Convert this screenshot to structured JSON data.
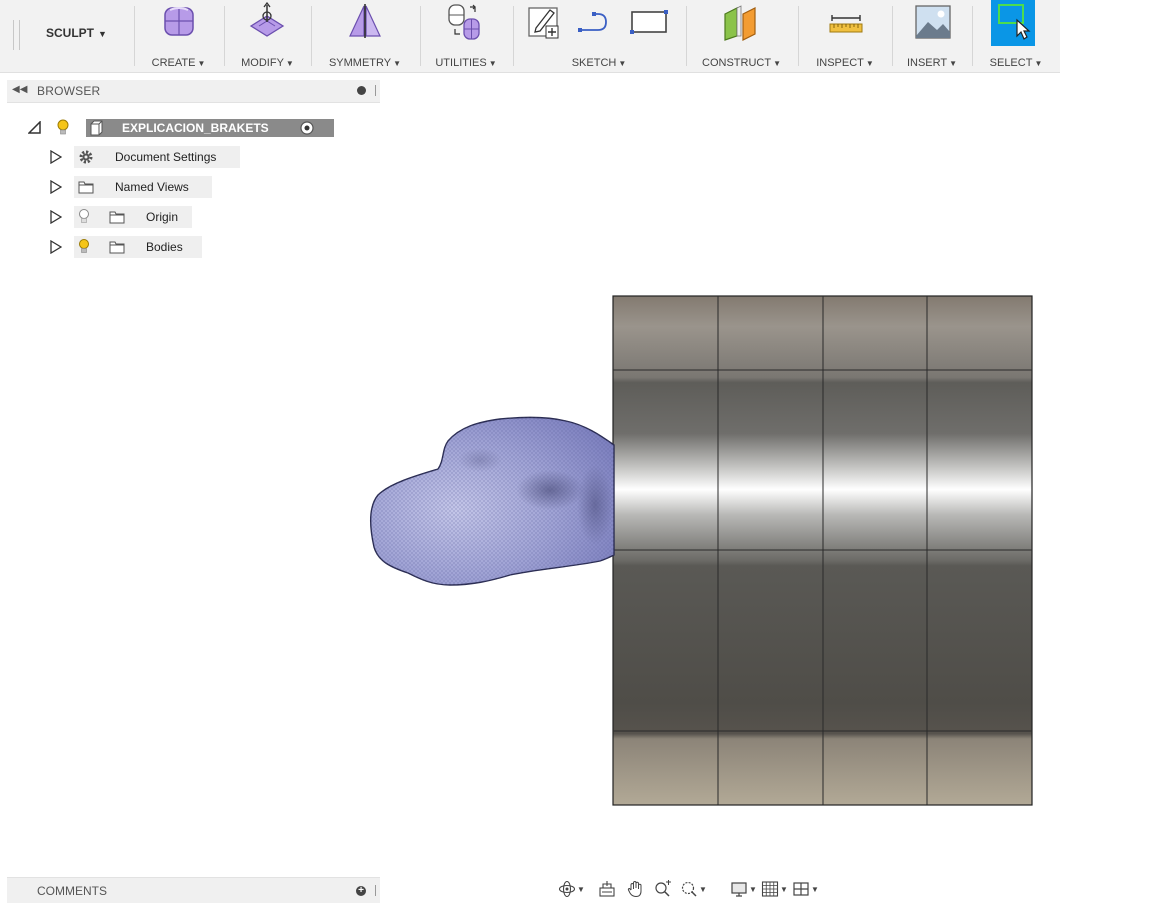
{
  "toolbar": {
    "workspace": "SCULPT",
    "groups": [
      {
        "label": "CREATE",
        "icon": "box-form-icon"
      },
      {
        "label": "MODIFY",
        "icon": "modify-form-icon"
      },
      {
        "label": "SYMMETRY",
        "icon": "symmetry-icon"
      },
      {
        "label": "UTILITIES",
        "icon": "utilities-icon"
      },
      {
        "label": "SKETCH",
        "icon": "sketch-icon"
      },
      {
        "label": "CONSTRUCT",
        "icon": "construct-plane-icon"
      },
      {
        "label": "INSPECT",
        "icon": "measure-icon"
      },
      {
        "label": "INSERT",
        "icon": "insert-image-icon"
      },
      {
        "label": "SELECT",
        "icon": "select-icon"
      }
    ],
    "colors": {
      "select_active": "#0a96e6",
      "form_purple": "#a98ce0"
    }
  },
  "browser": {
    "title": "BROWSER",
    "root": {
      "name": "EXPLICACION_BRAKETS"
    },
    "items": [
      {
        "label": "Document Settings",
        "icon": "gear-icon"
      },
      {
        "label": "Named Views",
        "icon": "folder-icon"
      },
      {
        "label": "Origin",
        "icon": "folder-icon"
      },
      {
        "label": "Bodies",
        "icon": "folder-icon"
      }
    ]
  },
  "comments": {
    "title": "COMMENTS"
  },
  "navbar": {
    "tools": [
      "orbit-icon",
      "look-at-icon",
      "pan-icon",
      "zoom-icon",
      "fit-icon",
      "display-settings-icon",
      "grid-icon",
      "viewports-icon"
    ]
  }
}
